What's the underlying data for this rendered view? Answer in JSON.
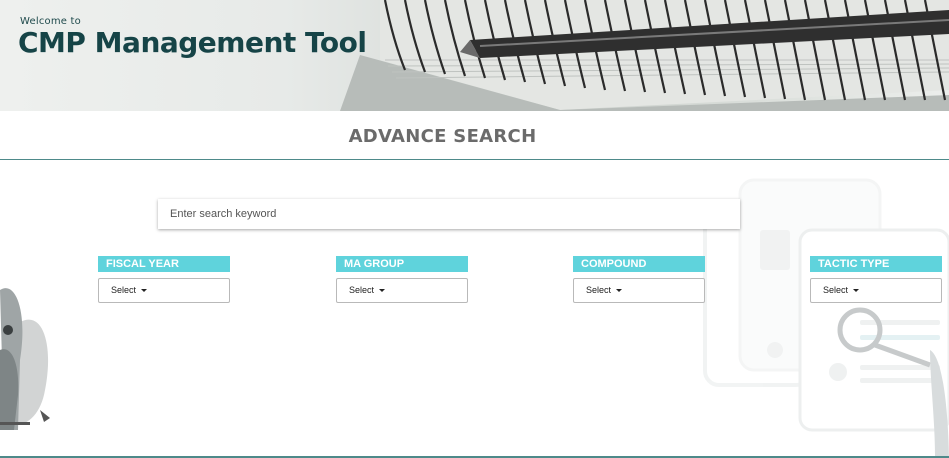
{
  "header": {
    "welcome_text": "Welcome to",
    "app_title": "CMP Management Tool"
  },
  "main": {
    "heading": "ADVANCE SEARCH",
    "search": {
      "placeholder": "Enter search keyword",
      "value": ""
    },
    "filters": [
      {
        "label": "FISCAL YEAR",
        "selected": "Select"
      },
      {
        "label": "MA GROUP",
        "selected": "Select"
      },
      {
        "label": "COMPOUND",
        "selected": "Select"
      },
      {
        "label": "TACTIC TYPE",
        "selected": "Select"
      }
    ]
  },
  "colors": {
    "accent_label_bg": "#5fd3dc",
    "title_color": "#164447",
    "rule_color": "#4e8a8a"
  },
  "icons": [
    "notebook-banner-image",
    "person-illustration",
    "document-magnifier-illustration",
    "caret-down-icon"
  ]
}
